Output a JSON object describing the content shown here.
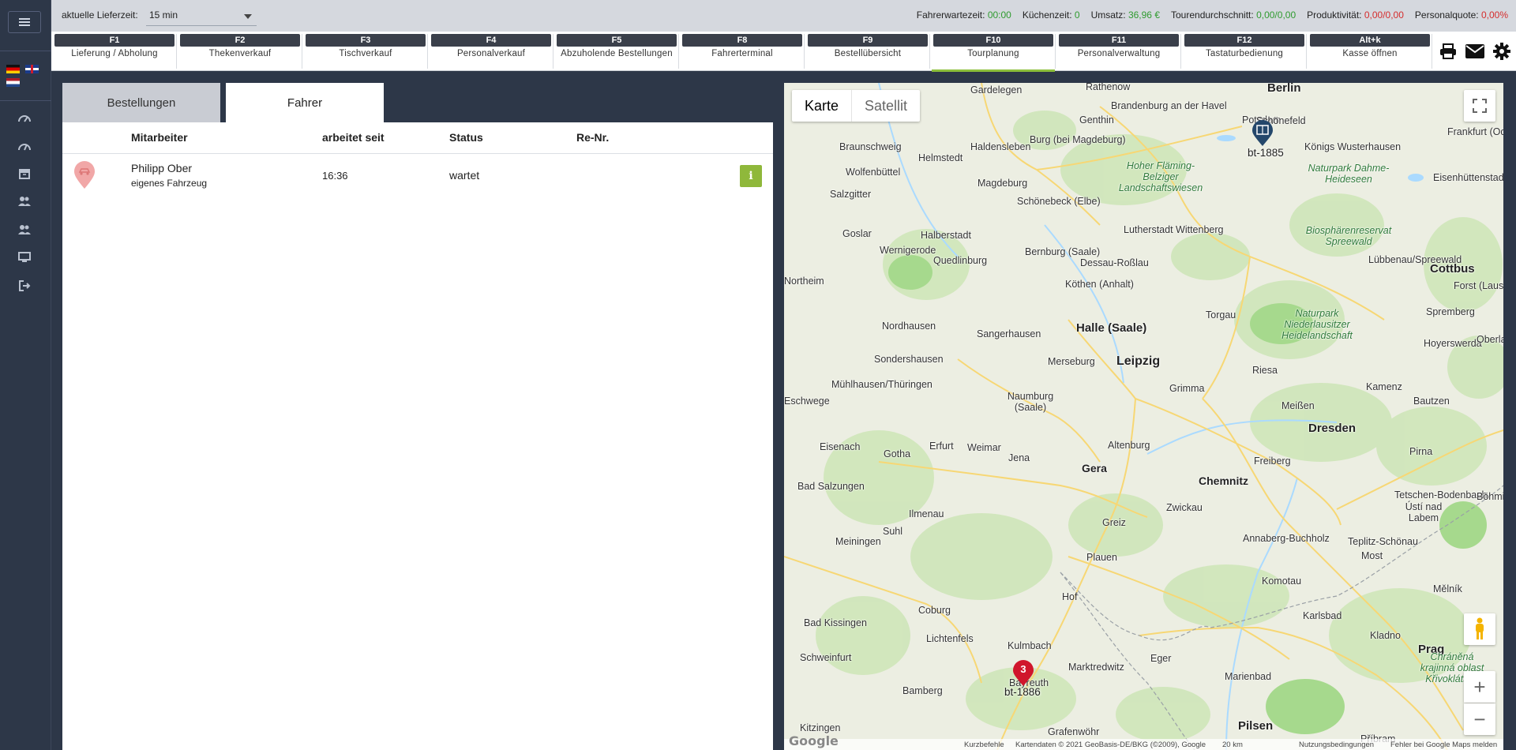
{
  "topbar": {
    "lieferzeit_label": "aktuelle Lieferzeit:",
    "lieferzeit_value": "15 min",
    "stats": [
      {
        "label": "Fahrerwartezeit:",
        "value": "00:00",
        "color": "green"
      },
      {
        "label": "Küchenzeit:",
        "value": "0",
        "color": "green"
      },
      {
        "label": "Umsatz:",
        "value": "36,96 €",
        "color": "green"
      },
      {
        "label": "Tourendurchschnitt:",
        "value": "0,00/0,00",
        "color": "green"
      },
      {
        "label": "Produktivität:",
        "value": "0,00/0,00",
        "color": "red"
      },
      {
        "label": "Personalquote:",
        "value": "0,00%",
        "color": "red"
      }
    ]
  },
  "fkeys": [
    {
      "key": "F1",
      "label": "Lieferung / Abholung"
    },
    {
      "key": "F2",
      "label": "Thekenverkauf"
    },
    {
      "key": "F3",
      "label": "Tischverkauf"
    },
    {
      "key": "F4",
      "label": "Personalverkauf"
    },
    {
      "key": "F5",
      "label": "Abzuholende Bestellungen"
    },
    {
      "key": "F8",
      "label": "Fahrerterminal"
    },
    {
      "key": "F9",
      "label": "Bestellübersicht"
    },
    {
      "key": "F10",
      "label": "Tourplanung"
    },
    {
      "key": "F11",
      "label": "Personalverwaltung"
    },
    {
      "key": "F12",
      "label": "Tastaturbedienung"
    },
    {
      "key": "Alt+k",
      "label": "Kasse öffnen"
    }
  ],
  "tabs": {
    "bestellungen": "Bestellungen",
    "fahrer": "Fahrer"
  },
  "table": {
    "headers": {
      "mitarbeiter": "Mitarbeiter",
      "arbeitet_seit": "arbeitet seit",
      "status": "Status",
      "re_nr": "Re-Nr."
    },
    "rows": [
      {
        "name": "Philipp Ober",
        "vehicle": "eigenes Fahrzeug",
        "since": "16:36",
        "status": "wartet",
        "re_nr": ""
      }
    ]
  },
  "map": {
    "type_karte": "Karte",
    "type_satellit": "Satellit",
    "markers": [
      {
        "label": "bt-1885"
      },
      {
        "label": "bt-1886",
        "count": "3"
      }
    ],
    "cities": [
      "Gardelegen",
      "Rathenow",
      "Berlin",
      "Brandenburg an der Havel",
      "Potsdam",
      "Schönefeld",
      "Genthin",
      "Braunschweig",
      "Helmstedt",
      "Haldensleben",
      "Burg (bei Magdeburg)",
      "Frankfurt (Oder)",
      "Königs Wusterhausen",
      "Wolfenbüttel",
      "Magdeburg",
      "Eisenhüttenstadt",
      "Salzgitter",
      "Schönebeck (Elbe)",
      "Goslar",
      "Halberstadt",
      "Lutherstadt Wittenberg",
      "Wernigerode",
      "Quedlinburg",
      "Bernburg (Saale)",
      "Dessau-Roßlau",
      "Cottbus",
      "Lübbenau/Spreewald",
      "Forst (Lausitz)",
      "Köthen (Anhalt)",
      "Nordhausen",
      "Sangerhausen",
      "Halle (Saale)",
      "Torgau",
      "Spremberg",
      "Hoyerswerda",
      "Sondershausen",
      "Merseburg",
      "Leipzig",
      "Riesa",
      "Mühlhausen/Thüringen",
      "Naumburg (Saale)",
      "Grimma",
      "Meißen",
      "Kamenz",
      "Bautzen",
      "Dresden",
      "Eisenach",
      "Gotha",
      "Erfurt",
      "Weimar",
      "Jena",
      "Gera",
      "Altenburg",
      "Freiberg",
      "Pirna",
      "Bad Salzungen",
      "Chemnitz",
      "Zwickau",
      "Tetschen-Bodenbach",
      "Ústí nad Labem",
      "Ilmenau",
      "Suhl",
      "Meiningen",
      "Greiz",
      "Annaberg-Buchholz",
      "Teplitz-Schönau",
      "Plauen",
      "Most",
      "Hof",
      "Komotau",
      "Bad Kissingen",
      "Coburg",
      "Lichtenfels",
      "Kulmbach",
      "Karlsbad",
      "Kladno",
      "Prag",
      "Schweinfurt",
      "Marktredwitz",
      "Eger",
      "Bamberg",
      "Bayreuth",
      "Marienbad",
      "Pilsen",
      "Kitzingen",
      "Grafenwöhr",
      "Příbram",
      "Mělník",
      "Böhmisch Leipa",
      "Oberlausitz",
      "Eschwege",
      "Northeim"
    ],
    "parks": [
      "Hoher Fläming-Belziger Landschaftswiesen",
      "Naturpark Dahme-Heideseen",
      "Biosphärenreservat Spreewald",
      "Naturpark Niederlausitzer Heidelandschaft",
      "Chráněná krajinná oblast Křivoklátsko"
    ],
    "attribution": {
      "logo": "Google",
      "shortcuts": "Kurzbefehle",
      "data": "Kartendaten © 2021 GeoBasis-DE/BKG (©2009), Google",
      "scale": "20 km",
      "terms": "Nutzungsbedingungen",
      "report": "Fehler bei Google Maps melden"
    }
  }
}
